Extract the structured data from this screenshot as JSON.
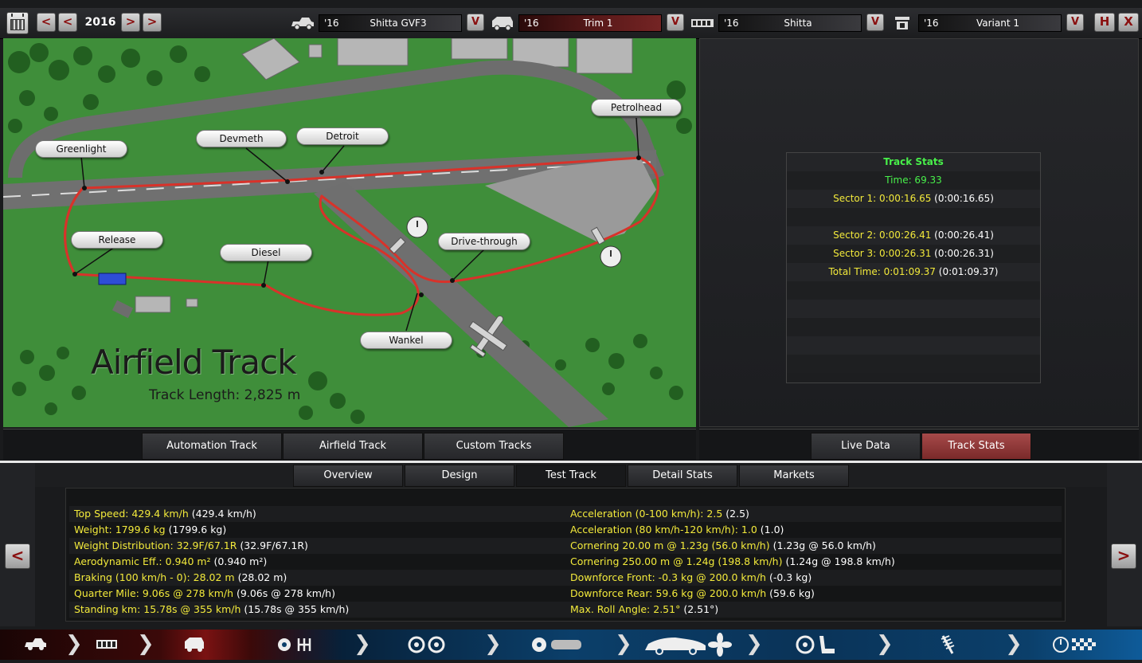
{
  "header": {
    "year": "2016",
    "prev_label": "<",
    "prev2_label": "<",
    "next_label": ">",
    "next2_label": ">",
    "selectors": [
      {
        "year": "'16",
        "name": "Shitta GVF3",
        "icon": "car-body-icon"
      },
      {
        "year": "'16",
        "name": "Trim 1",
        "icon": "car-trim-icon"
      },
      {
        "year": "'16",
        "name": "Shitta",
        "icon": "engine-family-icon"
      },
      {
        "year": "'16",
        "name": "Variant 1",
        "icon": "engine-variant-icon"
      }
    ],
    "dropdown_glyph": "V",
    "save_glyph": "H",
    "close_glyph": "X"
  },
  "map": {
    "title": "Airfield Track",
    "length_label": "Track Length: 2,825 m",
    "callouts": [
      "Greenlight",
      "Devmeth",
      "Detroit",
      "Petrolhead",
      "Release",
      "Diesel",
      "Drive-through",
      "Wankel"
    ]
  },
  "track_stats": {
    "title": "Track Stats",
    "time": "Time: 69.33",
    "sector1": "Sector 1: 0:00:16.65",
    "sector1_ref": "(0:00:16.65)",
    "sector2": "Sector 2: 0:00:26.41",
    "sector2_ref": "(0:00:26.41)",
    "sector3": "Sector 3: 0:00:26.31",
    "sector3_ref": "(0:00:26.31)",
    "total": "Total Time: 0:01:09.37",
    "total_ref": "(0:01:09.37)"
  },
  "track_tabs": [
    "Automation Track",
    "Airfield Track",
    "Custom Tracks"
  ],
  "right_tabs": [
    "Live Data",
    "Track Stats"
  ],
  "main_tabs": [
    "Overview",
    "Design",
    "Test Track",
    "Detail Stats",
    "Markets"
  ],
  "stats_left": [
    {
      "label": "Top Speed: 429.4 km/h",
      "ref": "(429.4 km/h)"
    },
    {
      "label": "Weight: 1799.6 kg",
      "ref": "(1799.6 kg)"
    },
    {
      "label": "Weight Distribution: 32.9F/67.1R",
      "ref": "(32.9F/67.1R)"
    },
    {
      "label": "Aerodynamic Eff.: 0.940 m²",
      "ref": "(0.940 m²)"
    },
    {
      "label": "Braking (100 km/h - 0): 28.02 m",
      "ref": "(28.02 m)"
    },
    {
      "label": "Quarter Mile: 9.06s @ 278 km/h",
      "ref": "(9.06s @ 278 km/h)"
    },
    {
      "label": "Standing km: 15.78s @ 355 km/h",
      "ref": "(15.78s @ 355 km/h)"
    }
  ],
  "stats_right": [
    {
      "label": "Acceleration (0-100 km/h): 2.5",
      "ref": "(2.5)"
    },
    {
      "label": "Acceleration (80 km/h-120 km/h): 1.0",
      "ref": "(1.0)"
    },
    {
      "label": "Cornering 20.00 m @ 1.23g (56.0 km/h)",
      "ref": "(1.23g @ 56.0 km/h)"
    },
    {
      "label": "Cornering 250.00 m @ 1.24g (198.8 km/h)",
      "ref": "(1.24g @ 198.8 km/h)"
    },
    {
      "label": "Downforce Front: -0.3 kg @ 200.0 km/h",
      "ref": "(-0.3 kg)"
    },
    {
      "label": "Downforce Rear: 59.6 kg @ 200.0 km/h",
      "ref": "(59.6 kg)"
    },
    {
      "label": "Max. Roll Angle: 2.51°",
      "ref": "(2.51°)"
    }
  ],
  "nav": {
    "left_arrow": "<",
    "right_arrow": ">",
    "items": [
      "car-model-icon",
      "engine-icon",
      "trim-icon",
      "gearbox-icon",
      "wheels-icon",
      "body-aero-icon",
      "interior-icon",
      "suspension-icon",
      "test-track-icon"
    ]
  },
  "colors": {
    "accent_red": "#7a1212",
    "stats_yellow": "#f3ea3b",
    "stats_green": "#48f04a",
    "grass": "#3f8e3a",
    "track_line": "#d8322a"
  }
}
